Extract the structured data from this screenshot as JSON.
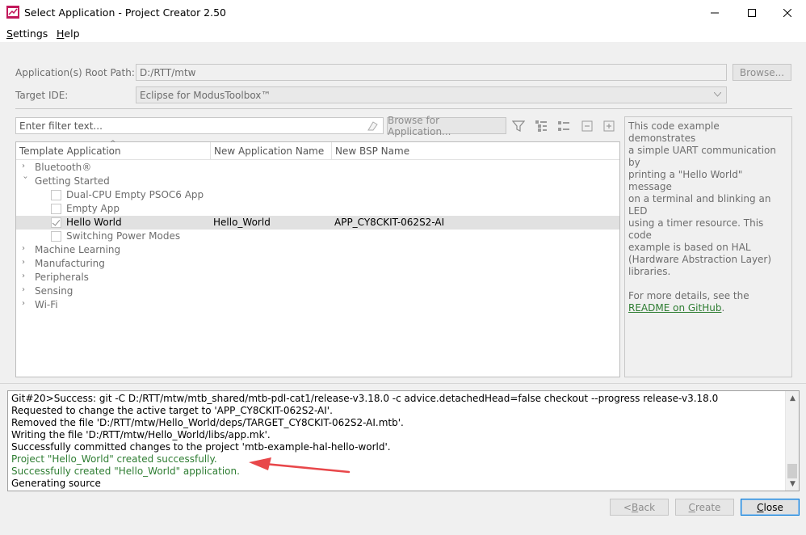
{
  "window": {
    "title": "Select Application - Project Creator 2.50",
    "minimize_icon": "minimize-icon",
    "maximize_icon": "maximize-icon",
    "close_icon": "close-icon"
  },
  "menu": {
    "settings": {
      "first": "S",
      "rest": "ettings"
    },
    "help": {
      "first": "H",
      "rest": "elp"
    }
  },
  "form": {
    "root_path_label": "Application(s) Root Path:",
    "root_path_value": "D:/RTT/mtw",
    "browse_label": "Browse...",
    "target_ide_label": "Target IDE:",
    "target_ide_value": "Eclipse for ModusToolbox™"
  },
  "filter": {
    "placeholder": "Enter filter text...",
    "browse_for_app_label": "Browse for Application..."
  },
  "tree": {
    "columns": [
      "Template Application",
      "New Application Name",
      "New BSP Name"
    ],
    "rows": [
      {
        "label": "Bluetooth®",
        "type": "category",
        "expanded": false
      },
      {
        "label": "Getting Started",
        "type": "category",
        "expanded": true
      },
      {
        "label": "Dual-CPU Empty PSOC6 App",
        "type": "item",
        "checked": false
      },
      {
        "label": "Empty App",
        "type": "item",
        "checked": false
      },
      {
        "label": "Hello World",
        "type": "item",
        "checked": true,
        "app_name": "Hello_World",
        "bsp_name": "APP_CY8CKIT-062S2-AI"
      },
      {
        "label": "Switching Power Modes",
        "type": "item",
        "checked": false
      },
      {
        "label": "Machine Learning",
        "type": "category",
        "expanded": false
      },
      {
        "label": "Manufacturing",
        "type": "category",
        "expanded": false
      },
      {
        "label": "Peripherals",
        "type": "category",
        "expanded": false
      },
      {
        "label": "Sensing",
        "type": "category",
        "expanded": false
      },
      {
        "label": "Wi-Fi",
        "type": "category",
        "expanded": false
      }
    ]
  },
  "description": {
    "lines": [
      "This code example demonstrates",
      "a simple UART communication by",
      "printing a \"Hello World\" message",
      "on a terminal and blinking an LED",
      "using a timer resource. This code",
      "example is based on HAL",
      "(Hardware Abstraction Layer)",
      "libraries."
    ],
    "details_prefix": "For more details, see the",
    "details_link": "README on GitHub",
    "details_suffix": "."
  },
  "log": {
    "lines": [
      {
        "text": "Git#20>Success: git -C D:/RTT/mtw/mtb_shared/mtb-pdl-cat1/release-v3.18.0 -c advice.detachedHead=false checkout --progress release-v3.18.0",
        "status": "normal"
      },
      {
        "text": "Requested to change the active target to 'APP_CY8CKIT-062S2-AI'.",
        "status": "normal"
      },
      {
        "text": "Removed the file 'D:/RTT/mtw/Hello_World/deps/TARGET_CY8CKIT-062S2-AI.mtb'.",
        "status": "normal"
      },
      {
        "text": "Writing the file 'D:/RTT/mtw/Hello_World/libs/app.mk'.",
        "status": "normal"
      },
      {
        "text": "Successfully committed changes to the project 'mtb-example-hal-hello-world'.",
        "status": "normal"
      },
      {
        "text": "Project \"Hello_World\" created successfully.",
        "status": "ok"
      },
      {
        "text": "Successfully created \"Hello_World\" application.",
        "status": "ok"
      },
      {
        "text": "Generating source",
        "status": "normal"
      }
    ]
  },
  "buttons": {
    "back_prefix": "< ",
    "back_first": "B",
    "back_rest": "ack",
    "create_first": "C",
    "create_rest": "reate",
    "close_first": "C",
    "close_rest": "lose"
  },
  "colors": {
    "success_text": "#2e7d32",
    "annotation_arrow": "#e8474a"
  }
}
